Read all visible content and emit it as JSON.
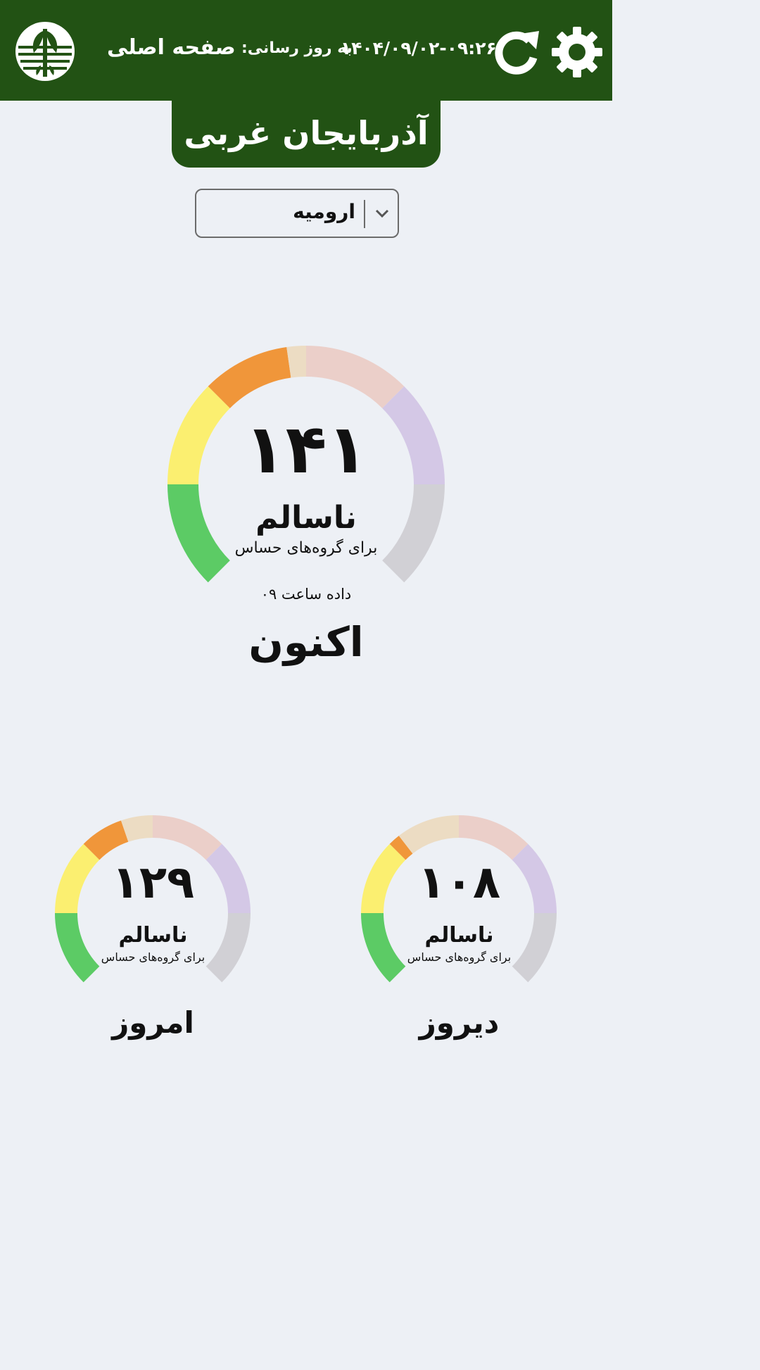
{
  "header": {
    "page_title": "صفحه اصلی",
    "update_label": "به روز رسانی:",
    "update_time": "۱۴۰۴/۰۹/۰۲-۰۹:۲۶",
    "background_color": "#225214",
    "icons": {
      "logo": "environment-logo-icon",
      "refresh": "refresh-icon",
      "settings": "gear-icon"
    }
  },
  "province": {
    "name": "آذربایجان غربی"
  },
  "city_select": {
    "selected": "ارومیه",
    "icon": "chevron-down-icon"
  },
  "gauge_colors": [
    "#5ccb65",
    "#fbef70",
    "#f0963a",
    "#ecdcc3",
    "#ebcfc9",
    "#d4c8e6",
    "#d1d0d5"
  ],
  "gauges": {
    "now": {
      "value": "۱۴۱",
      "aqi": 141,
      "status": "ناسالم",
      "status_sub": "برای گروه‌های حساس",
      "note": "داده ساعت ۰۹",
      "label": "اکنون"
    },
    "today": {
      "value": "۱۲۹",
      "aqi": 129,
      "status": "ناسالم",
      "status_sub": "برای گروه‌های حساس",
      "label": "امروز"
    },
    "yesterday": {
      "value": "۱۰۸",
      "aqi": 108,
      "status": "ناسالم",
      "status_sub": "برای گروه‌های حساس",
      "label": "دیروز"
    }
  }
}
